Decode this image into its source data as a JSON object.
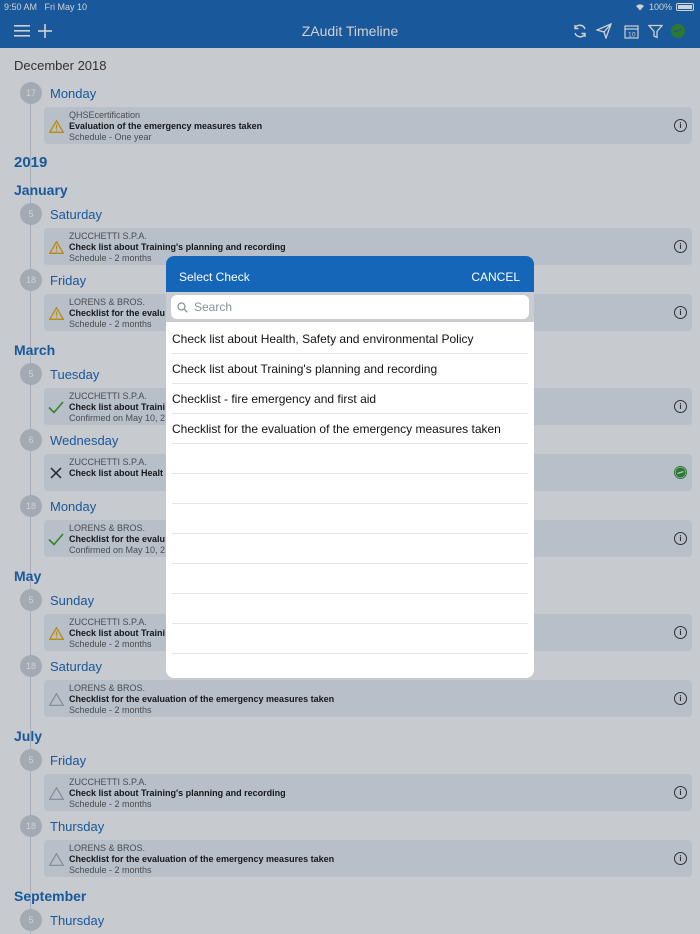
{
  "status": {
    "time": "9:50 AM",
    "date": "Fri May 10",
    "battery": "100%"
  },
  "nav": {
    "title": "ZAudit Timeline",
    "icons": [
      "menu-icon",
      "add-icon",
      "refresh-icon",
      "send-icon",
      "calendar-icon",
      "filter-icon",
      "sync-status-icon"
    ]
  },
  "colors": {
    "brand": "#1565b8",
    "warning": "#e5a400",
    "success": "#3a9b2a",
    "sync": "#2f8f2f"
  },
  "timeline": {
    "header_month": "December 2018",
    "dec_day": {
      "num": "17",
      "name": "Monday"
    },
    "dec_card": {
      "org": "QHSEcertification",
      "title": "Evaluation of the emergency measures taken",
      "sub": "Schedule - One year",
      "icon": "warning-icon"
    },
    "year": "2019",
    "months": {
      "january": "January",
      "march": "March",
      "may": "May",
      "july": "July",
      "september": "September"
    },
    "days": [
      {
        "num": "5",
        "name": "Saturday"
      },
      {
        "num": "18",
        "name": "Friday"
      },
      {
        "num": "5",
        "name": "Tuesday"
      },
      {
        "num": "6",
        "name": "Wednesday"
      },
      {
        "num": "18",
        "name": "Monday"
      },
      {
        "num": "5",
        "name": "Sunday"
      },
      {
        "num": "18",
        "name": "Saturday"
      },
      {
        "num": "5",
        "name": "Friday"
      },
      {
        "num": "18",
        "name": "Thursday"
      },
      {
        "num": "5",
        "name": "Thursday"
      }
    ],
    "cards": [
      {
        "org": "ZUCCHETTI S.P.A.",
        "title": "Check list about Training's planning and recording",
        "sub": "Schedule - 2 months",
        "icon": "warning-icon"
      },
      {
        "org": "LORENS & BROS.",
        "title": "Checklist for the evalu",
        "sub": "Schedule - 2 months",
        "icon": "warning-icon"
      },
      {
        "org": "ZUCCHETTI S.P.A.",
        "title": "Check list about Traini",
        "sub": "Confirmed on May 10, 2",
        "icon": "check-icon"
      },
      {
        "org": "ZUCCHETTI S.P.A.",
        "title": "Check list about Healt",
        "sub": "",
        "icon": "x-icon"
      },
      {
        "org": "LORENS & BROS.",
        "title": "Checklist for the evalu",
        "sub": "Confirmed on May 10, 2",
        "icon": "check-icon"
      },
      {
        "org": "ZUCCHETTI S.P.A.",
        "title": "Check list about Traini",
        "sub": "Schedule - 2 months",
        "icon": "warning-icon"
      },
      {
        "org": "LORENS & BROS.",
        "title": "Checklist for the evaluation of the emergency measures taken",
        "sub": "Schedule - 2 months",
        "icon": "warning-outline-icon"
      },
      {
        "org": "ZUCCHETTI S.P.A.",
        "title": "Check list about Training's planning and recording",
        "sub": "Schedule - 2 months",
        "icon": "warning-outline-icon"
      },
      {
        "org": "LORENS & BROS.",
        "title": "Checklist for the evaluation of the emergency measures taken",
        "sub": "Schedule - 2 months",
        "icon": "warning-outline-icon"
      }
    ]
  },
  "modal": {
    "title": "Select Check",
    "cancel_label": "CANCEL",
    "search_placeholder": "Search",
    "items": [
      "Check list about Health, Safety and environmental Policy",
      "Check list about Training's planning and recording",
      "Checklist - fire emergency and first aid",
      "Checklist for the evaluation of the emergency measures taken"
    ]
  }
}
